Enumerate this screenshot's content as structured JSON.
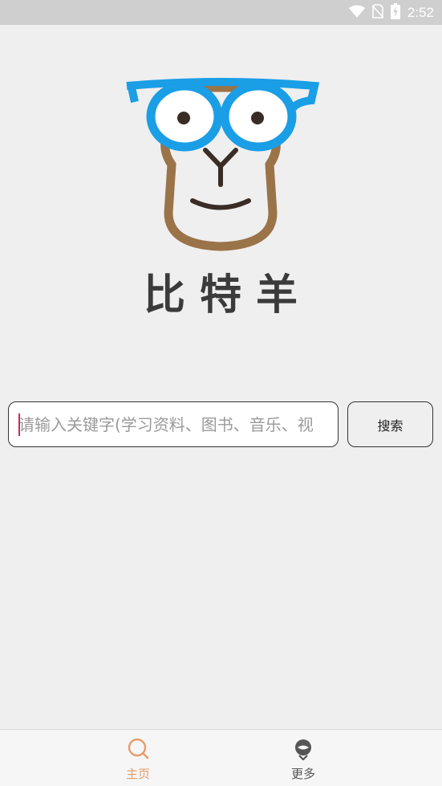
{
  "status_bar": {
    "time": "2:52",
    "icons": [
      "wifi-icon",
      "no-sim-icon",
      "battery-charging-icon"
    ]
  },
  "logo": {
    "name": "比特羊",
    "icon": "sheep-with-glasses-logo"
  },
  "search": {
    "placeholder": "请输入关键字(学习资料、图书、音乐、视",
    "value": "",
    "button_label": "搜索"
  },
  "bottom_nav": {
    "items": [
      {
        "label": "主页",
        "icon": "search-icon",
        "active": true
      },
      {
        "label": "更多",
        "icon": "more-icon",
        "active": false
      }
    ]
  },
  "colors": {
    "accent": "#e79b6a",
    "glasses": "#1a9ee6",
    "face": "#9a7348",
    "background": "#efefef"
  }
}
